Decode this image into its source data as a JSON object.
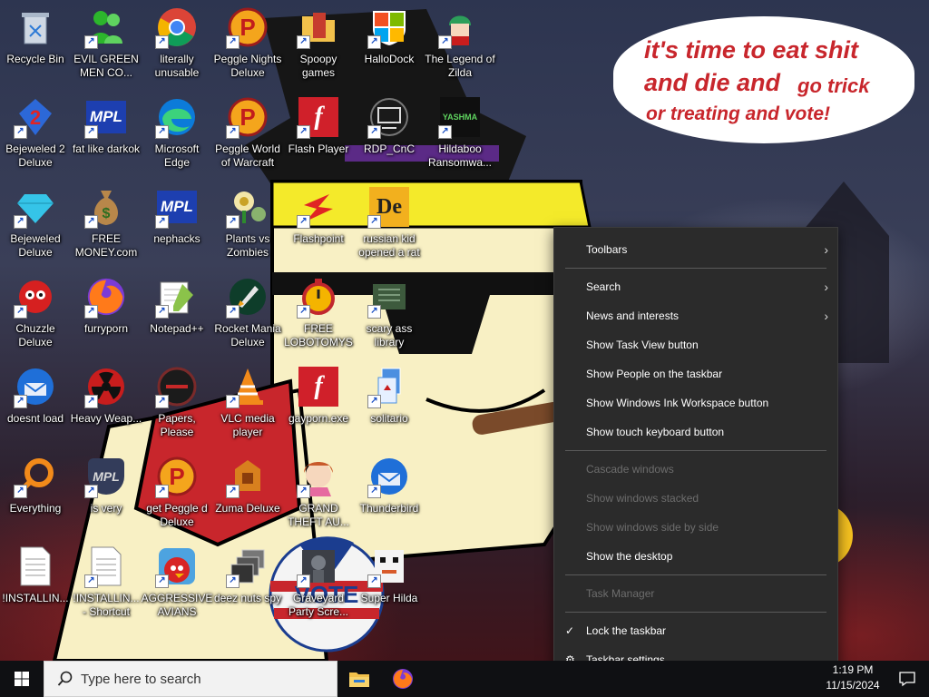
{
  "desktop": {
    "speech_lines": [
      "it's time to eat shit",
      "and die and",
      "go trick",
      "or treating and vote!"
    ],
    "sticker_text": "VOTE",
    "icons": [
      {
        "label": "Recycle Bin",
        "icon": "recycle-bin-icon",
        "shortcut": false
      },
      {
        "label": "Bejeweled 2 Deluxe",
        "icon": "bejeweled2-icon",
        "shortcut": true
      },
      {
        "label": "Bejeweled Deluxe",
        "icon": "bejeweled-icon",
        "shortcut": true
      },
      {
        "label": "Chuzzle Deluxe",
        "icon": "chuzzle-icon",
        "shortcut": true
      },
      {
        "label": "doesnt load",
        "icon": "thunderbird-icon",
        "shortcut": true
      },
      {
        "label": "Everything",
        "icon": "everything-search-icon",
        "shortcut": true
      },
      {
        "label": "!INSTALLIN...",
        "icon": "text-file-icon",
        "shortcut": false
      },
      {
        "label": "EVIL GREEN MEN CO...",
        "icon": "messenger-icon",
        "shortcut": true
      },
      {
        "label": "fat like darkok",
        "icon": "mpl-icon",
        "shortcut": true
      },
      {
        "label": "FREE MONEY.com",
        "icon": "money-bag-icon",
        "shortcut": true
      },
      {
        "label": "furryporn",
        "icon": "firefox-icon",
        "shortcut": true
      },
      {
        "label": "Heavy Weap...",
        "icon": "radiation-icon",
        "shortcut": true
      },
      {
        "label": "is very",
        "icon": "mpl-shield-icon",
        "shortcut": true
      },
      {
        "label": "!INSTALLIN... - Shortcut",
        "icon": "text-file-icon",
        "shortcut": true
      },
      {
        "label": "literally unusable",
        "icon": "chrome-icon",
        "shortcut": true
      },
      {
        "label": "Microsoft Edge",
        "icon": "edge-icon",
        "shortcut": true
      },
      {
        "label": "nephacks",
        "icon": "mpl-icon",
        "shortcut": true
      },
      {
        "label": "Notepad++",
        "icon": "notepad-plus-icon",
        "shortcut": true
      },
      {
        "label": "Papers, Please",
        "icon": "papers-please-icon",
        "shortcut": true
      },
      {
        "label": "get Peggle d Deluxe",
        "icon": "peggle-icon",
        "shortcut": true
      },
      {
        "label": "AGGRESSIVE AVIANS",
        "icon": "angry-bird-icon",
        "shortcut": true
      },
      {
        "label": "Peggle Nights Deluxe",
        "icon": "peggle-icon",
        "shortcut": true
      },
      {
        "label": "Peggle World of Warcraft",
        "icon": "peggle-icon",
        "shortcut": true
      },
      {
        "label": "Plants vs Zombies",
        "icon": "plants-vs-zombies-icon",
        "shortcut": true
      },
      {
        "label": "Rocket Mania Deluxe",
        "icon": "rocket-mania-icon",
        "shortcut": true
      },
      {
        "label": "VLC media player",
        "icon": "vlc-cone-icon",
        "shortcut": true
      },
      {
        "label": "Zuma Deluxe",
        "icon": "zuma-icon",
        "shortcut": true
      },
      {
        "label": "deez nuts spy",
        "icon": "window-stack-icon",
        "shortcut": true
      },
      {
        "label": "Spoopy games",
        "icon": "folder-icon",
        "shortcut": true
      },
      {
        "label": "Flash Player",
        "icon": "flash-icon",
        "shortcut": true
      },
      {
        "label": "Flashpoint",
        "icon": "flashpoint-icon",
        "shortcut": true
      },
      {
        "label": "FREE LOBOTOMYS",
        "icon": "stopwatch-icon",
        "shortcut": true
      },
      {
        "label": "gayporn.exe",
        "icon": "flash-icon",
        "shortcut": false
      },
      {
        "label": "GRAND THEFT AU...",
        "icon": "anime-girl-icon",
        "shortcut": true
      },
      {
        "label": "Graveyard Party Scre...",
        "icon": "screensaver-icon",
        "shortcut": true
      },
      {
        "label": "HalloDock",
        "icon": "windows-shield-icon",
        "shortcut": true
      },
      {
        "label": "RDP_CnC",
        "icon": "rdp-icon",
        "shortcut": true
      },
      {
        "label": "russian kid opened a rat",
        "icon": "de-icon",
        "shortcut": true
      },
      {
        "label": "scary ass library",
        "icon": "library-shield-icon",
        "shortcut": true
      },
      {
        "label": "solitario",
        "icon": "solitaire-icon",
        "shortcut": true
      },
      {
        "label": "Thunderbird",
        "icon": "thunderbird-icon",
        "shortcut": true
      },
      {
        "label": "Super Hilda",
        "icon": "pixel-sprite-icon",
        "shortcut": true
      },
      {
        "label": "The Legend of Zilda",
        "icon": "zelda-sprite-icon",
        "shortcut": true
      },
      {
        "label": "Hildaboo Ransomwa...",
        "icon": "yashma-icon",
        "shortcut": true
      }
    ]
  },
  "context_menu": {
    "items": [
      {
        "label": "Toolbars",
        "submenu": true,
        "disabled": false,
        "checked": false
      },
      {
        "label": "Search",
        "submenu": true,
        "disabled": false,
        "checked": false
      },
      {
        "label": "News and interests",
        "submenu": true,
        "disabled": false,
        "checked": false
      },
      {
        "label": "Show Task View button",
        "submenu": false,
        "disabled": false,
        "checked": false
      },
      {
        "label": "Show People on the taskbar",
        "submenu": false,
        "disabled": false,
        "checked": false
      },
      {
        "label": "Show Windows Ink Workspace button",
        "submenu": false,
        "disabled": false,
        "checked": false
      },
      {
        "label": "Show touch keyboard button",
        "submenu": false,
        "disabled": false,
        "checked": false
      },
      {
        "label": "Cascade windows",
        "submenu": false,
        "disabled": true,
        "checked": false
      },
      {
        "label": "Show windows stacked",
        "submenu": false,
        "disabled": true,
        "checked": false
      },
      {
        "label": "Show windows side by side",
        "submenu": false,
        "disabled": true,
        "checked": false
      },
      {
        "label": "Show the desktop",
        "submenu": false,
        "disabled": false,
        "checked": false
      },
      {
        "label": "Task Manager",
        "submenu": false,
        "disabled": true,
        "checked": false
      },
      {
        "label": "Lock the taskbar",
        "submenu": false,
        "disabled": false,
        "checked": true
      },
      {
        "label": "Taskbar settings",
        "submenu": false,
        "disabled": false,
        "checked": false,
        "icon": "gear-icon"
      }
    ]
  },
  "taskbar": {
    "search_placeholder": "Type here to search",
    "pinned": [
      {
        "icon": "file-explorer-icon"
      },
      {
        "icon": "firefox-icon"
      }
    ],
    "time": "1:19 PM",
    "date": "11/15/2024"
  },
  "colors": {
    "menu_bg": "#2b2b2b",
    "taskbar_bg": "#0f1013",
    "speech_text": "#c8262c",
    "accent": "#1a73e8"
  }
}
